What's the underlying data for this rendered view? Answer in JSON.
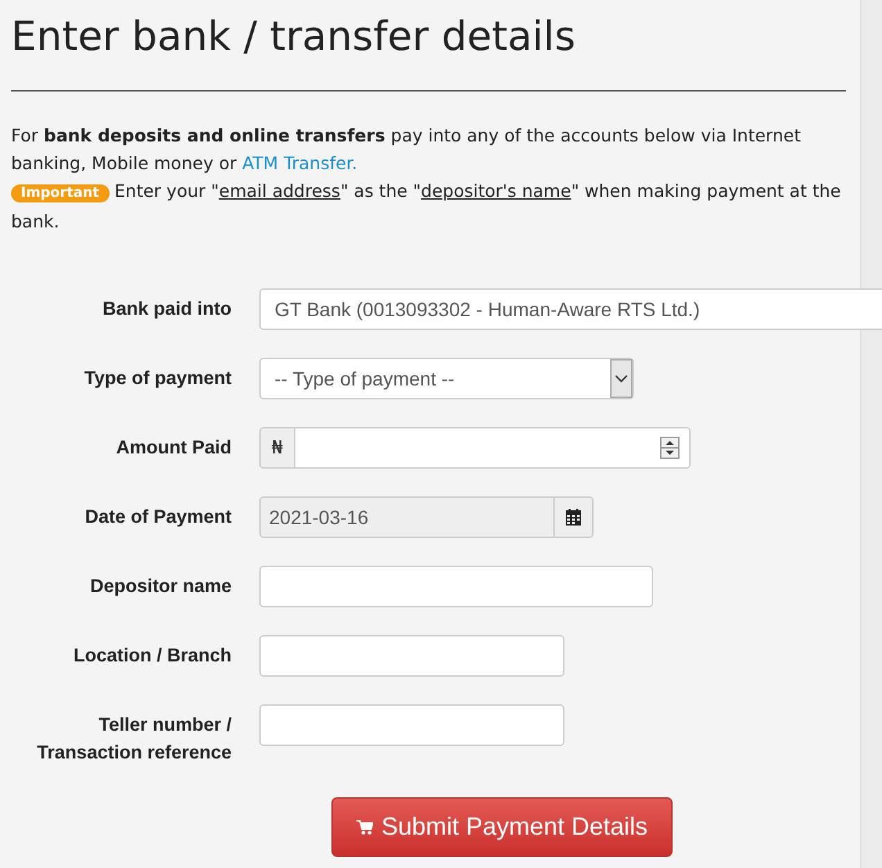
{
  "title": "Enter bank / transfer details",
  "intro": {
    "text": "For **bank deposits and online transfers** pay into any of the accounts below via Internet banking, Mobile money or",
    "link": "ATM Transfer."
  },
  "notice": {
    "badge": "Important",
    "segments": [
      {
        "text": "Enter your \"",
        "underline": false
      },
      {
        "text": "email address",
        "underline": true
      },
      {
        "text": "\" as the \"",
        "underline": false
      },
      {
        "text": "depositor's name",
        "underline": true
      },
      {
        "text": "\" when making payment at the bank.",
        "underline": false
      }
    ]
  },
  "fields": [
    {
      "label": "Bank paid into",
      "kind": "text",
      "value": "GT Bank (0013093302 - Human-Aware RTS Ltd.)",
      "disabled": false
    },
    {
      "label": "Type of payment",
      "kind": "select",
      "value": "-- Type of payment --",
      "disabled": false
    },
    {
      "label": "Amount Paid",
      "kind": "number",
      "prefix": "₦",
      "disabled": false
    },
    {
      "label": "Date of Payment",
      "kind": "date",
      "value": "2021-03-16",
      "disabled": true
    },
    {
      "label": "Depositor name",
      "kind": "text",
      "disabled": false
    },
    {
      "label": "Location / Branch",
      "kind": "text",
      "disabled": false
    },
    {
      "label": "Teller number / Transaction reference",
      "kind": "text",
      "disabled": false
    }
  ],
  "submit": "Submit Payment Details"
}
